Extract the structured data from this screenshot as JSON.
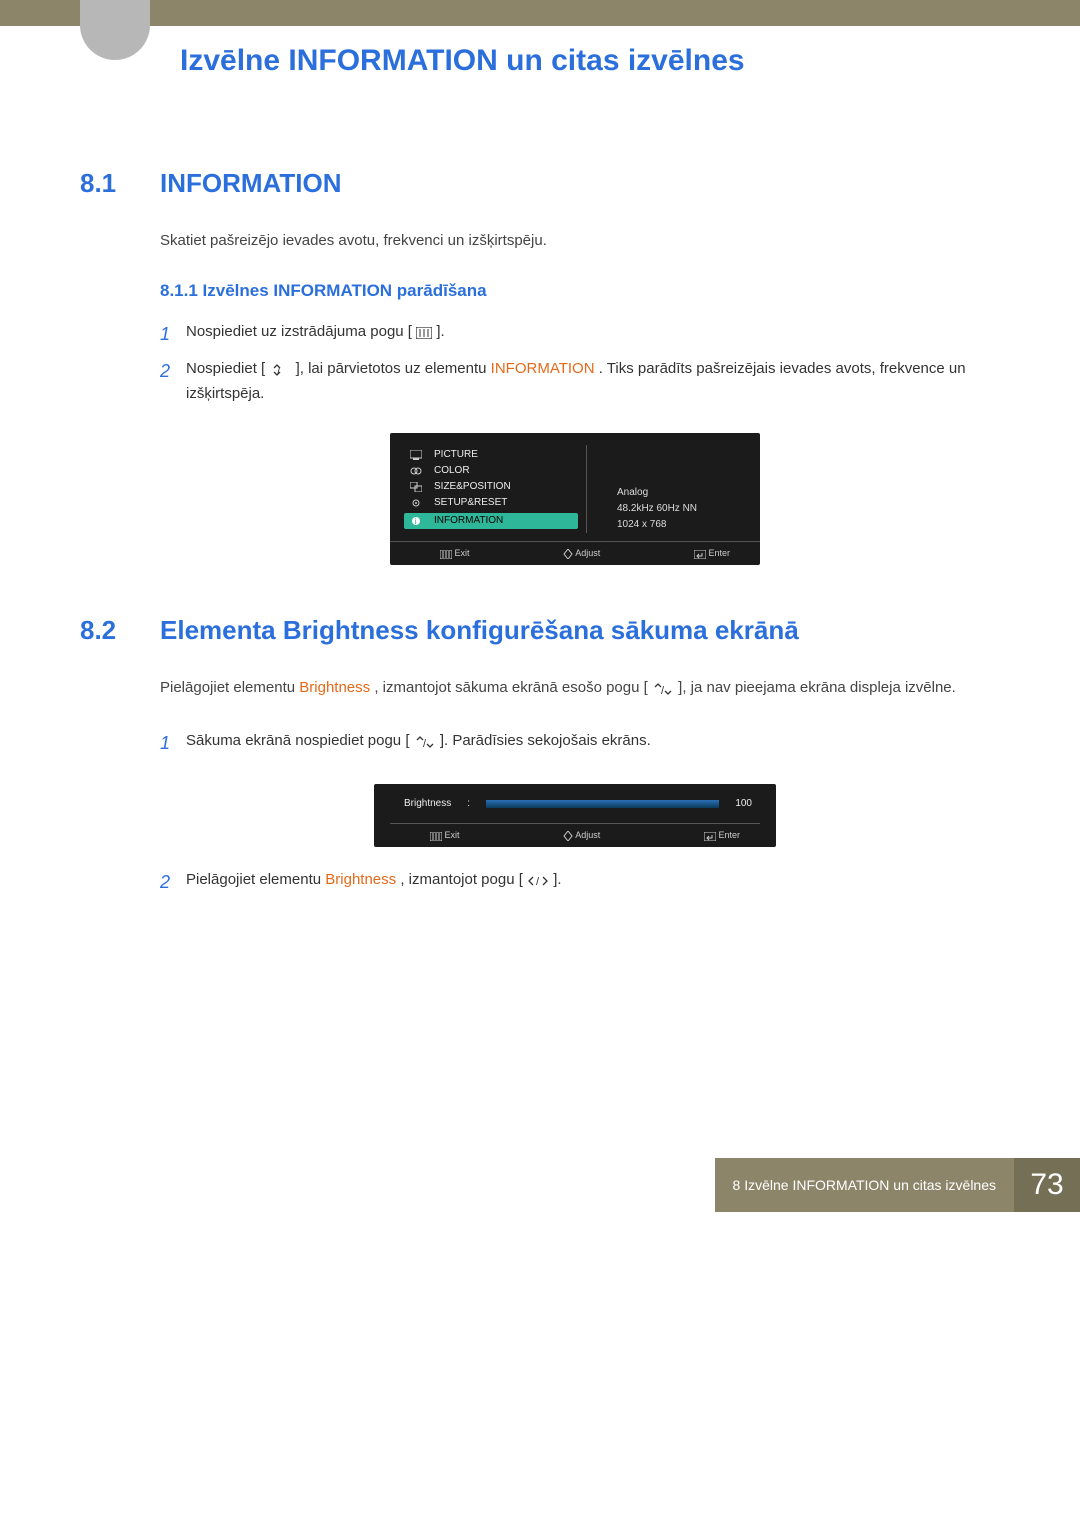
{
  "chapter_title": "Izvēlne INFORMATION un citas izvēlnes",
  "section1": {
    "num": "8.1",
    "title": "INFORMATION",
    "intro": "Skatiet pašreizējo ievades avotu, frekvenci un izšķirtspēju.",
    "sub": {
      "num_title": "8.1.1   Izvēlnes INFORMATION parādīšana",
      "step1": "Nospiediet uz izstrādājuma pogu [",
      "step1_after": "].",
      "step2_a": "Nospiediet [",
      "step2_b": "], lai pārvietotos uz elementu ",
      "step2_hl": "INFORMATION",
      "step2_c": ". Tiks parādīts pašreizējais ievades avots, frekvence un izšķirtspēja."
    }
  },
  "osd": {
    "items": [
      "PICTURE",
      "COLOR",
      "SIZE&POSITION",
      "SETUP&RESET",
      "INFORMATION"
    ],
    "info": [
      "Analog",
      "48.2kHz 60Hz NN",
      "1024 x 768"
    ],
    "exit": "Exit",
    "adjust": "Adjust",
    "enter": "Enter"
  },
  "section2": {
    "num": "8.2",
    "title": "Elementa Brightness konfigurēšana sākuma ekrānā",
    "intro_a": "Pielāgojiet elementu ",
    "intro_hl": "Brightness",
    "intro_b": ", izmantojot sākuma ekrānā esošo pogu [",
    "intro_c": "], ja nav pieejama ekrāna displeja izvēlne.",
    "step1_a": "Sākuma ekrānā nospiediet pogu [",
    "step1_b": "]. Parādīsies sekojošais ekrāns.",
    "step2_a": "Pielāgojiet elementu ",
    "step2_hl": "Brightness",
    "step2_b": ", izmantojot pogu [",
    "step2_c": "]."
  },
  "brightness": {
    "label": "Brightness",
    "value": "100",
    "exit": "Exit",
    "adjust": "Adjust",
    "enter": "Enter"
  },
  "footer": {
    "label": "8 Izvēlne INFORMATION un citas izvēlnes",
    "page": "73"
  }
}
